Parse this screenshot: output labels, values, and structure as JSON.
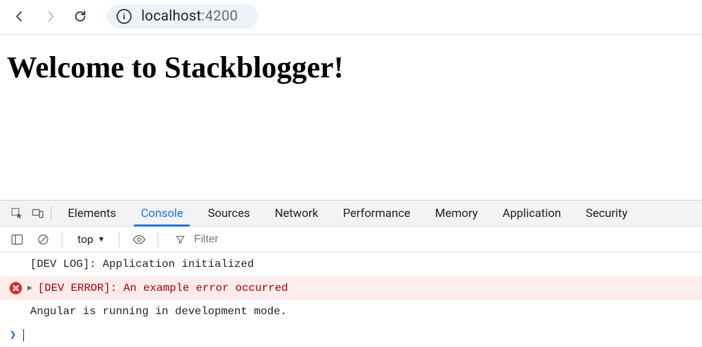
{
  "browser": {
    "url_host": "localhost",
    "url_port": ":4200"
  },
  "page": {
    "heading": "Welcome to Stackblogger!"
  },
  "devtools": {
    "tabs": {
      "elements": "Elements",
      "console": "Console",
      "sources": "Sources",
      "network": "Network",
      "performance": "Performance",
      "memory": "Memory",
      "application": "Application",
      "security": "Security"
    },
    "context_label": "top",
    "filter_placeholder": "Filter",
    "logs": [
      {
        "kind": "default",
        "text": "[DEV LOG]: Application initialized"
      },
      {
        "kind": "error",
        "text": "[DEV ERROR]: An example error occurred"
      },
      {
        "kind": "default",
        "text": "Angular is running in development mode."
      }
    ],
    "prompt_symbol": "❯"
  }
}
